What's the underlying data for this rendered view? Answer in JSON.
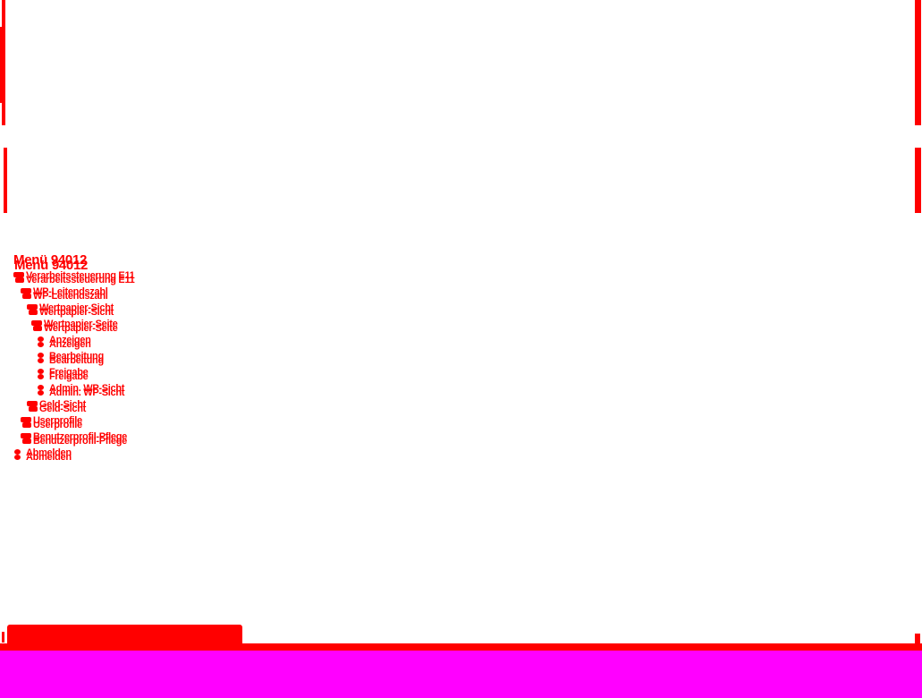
{
  "menu": {
    "title": "Menü 94012",
    "items": [
      {
        "label": "Verarbeitssteuerung E11",
        "icon": "folder-icon",
        "level": 0
      },
      {
        "label": "WP-Leitendszahl",
        "icon": "folder-icon",
        "level": 1
      },
      {
        "label": "Wertpapier-Sicht",
        "icon": "folder-icon",
        "level": 2
      },
      {
        "label": "Wertpapier-Seite",
        "icon": "folder-icon",
        "level": 3
      },
      {
        "label": "Anzeigen",
        "icon": "bullet-icon",
        "level": 4
      },
      {
        "label": "Bearbeitung",
        "icon": "bullet-icon",
        "level": 4
      },
      {
        "label": "Freigabe",
        "icon": "bullet-icon",
        "level": 4
      },
      {
        "label": "Admin. WP-Sicht",
        "icon": "bullet-icon",
        "level": 4
      },
      {
        "label": "Geld-Sicht",
        "icon": "folder-icon",
        "level": 2
      },
      {
        "label": "Userprofile",
        "icon": "folder-icon",
        "level": 1
      },
      {
        "label": "Benutzerprofil-Pflege",
        "icon": "folder-icon",
        "level": 1
      },
      {
        "label": "Abmelden",
        "icon": "bullet-icon",
        "level": 0
      }
    ]
  },
  "colors": {
    "accent": "#ff0000",
    "band": "#ff00ff",
    "background": "#ffffff"
  }
}
